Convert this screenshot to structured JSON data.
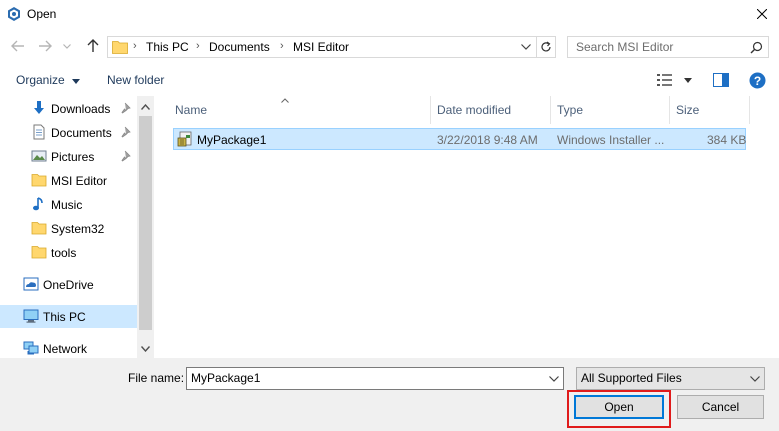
{
  "window": {
    "title": "Open",
    "app_icon": "app-logo-icon",
    "close_icon": "close-icon"
  },
  "nav": {
    "back_icon": "back-arrow-icon",
    "forward_icon": "forward-arrow-icon",
    "recent_icon": "chevron-down-icon",
    "up_icon": "up-arrow-icon"
  },
  "address": {
    "folder_icon": "folder-icon",
    "crumbs": [
      "This PC",
      "Documents",
      "MSI Editor"
    ],
    "dropdown_icon": "chevron-down-icon",
    "refresh_icon": "refresh-icon"
  },
  "search": {
    "placeholder": "Search MSI Editor",
    "icon": "search-icon"
  },
  "toolbar": {
    "organize_label": "Organize",
    "new_folder_label": "New folder",
    "view_icon": "view-options-icon",
    "preview_icon": "preview-pane-icon",
    "help_icon": "help-icon"
  },
  "sidebar": {
    "items": [
      {
        "label": "Downloads",
        "icon": "download-icon",
        "pinned": true
      },
      {
        "label": "Documents",
        "icon": "documents-icon",
        "pinned": true
      },
      {
        "label": "Pictures",
        "icon": "pictures-icon",
        "pinned": true
      },
      {
        "label": "MSI Editor",
        "icon": "folder-icon",
        "pinned": false
      },
      {
        "label": "Music",
        "icon": "music-icon",
        "pinned": false
      },
      {
        "label": "System32",
        "icon": "folder-icon",
        "pinned": false
      },
      {
        "label": "tools",
        "icon": "folder-icon",
        "pinned": false
      },
      {
        "label": "OneDrive",
        "icon": "onedrive-icon",
        "pinned": false
      },
      {
        "label": "This PC",
        "icon": "computer-icon",
        "pinned": false,
        "selected": true
      },
      {
        "label": "Network",
        "icon": "network-icon",
        "pinned": false
      }
    ]
  },
  "filelist": {
    "columns": [
      "Name",
      "Date modified",
      "Type",
      "Size"
    ],
    "rows": [
      {
        "name": "MyPackage1",
        "date": "3/22/2018 9:48 AM",
        "type": "Windows Installer ...",
        "size": "384 KB",
        "icon": "msi-package-icon",
        "selected": true
      }
    ]
  },
  "bottom": {
    "file_name_label": "File name:",
    "file_name_value": "MyPackage1",
    "filter_value": "All Supported Files",
    "open_label": "Open",
    "cancel_label": "Cancel"
  },
  "colors": {
    "selection": "#cce8ff",
    "accent": "#0078d7",
    "annotation": "#e01b1b"
  }
}
